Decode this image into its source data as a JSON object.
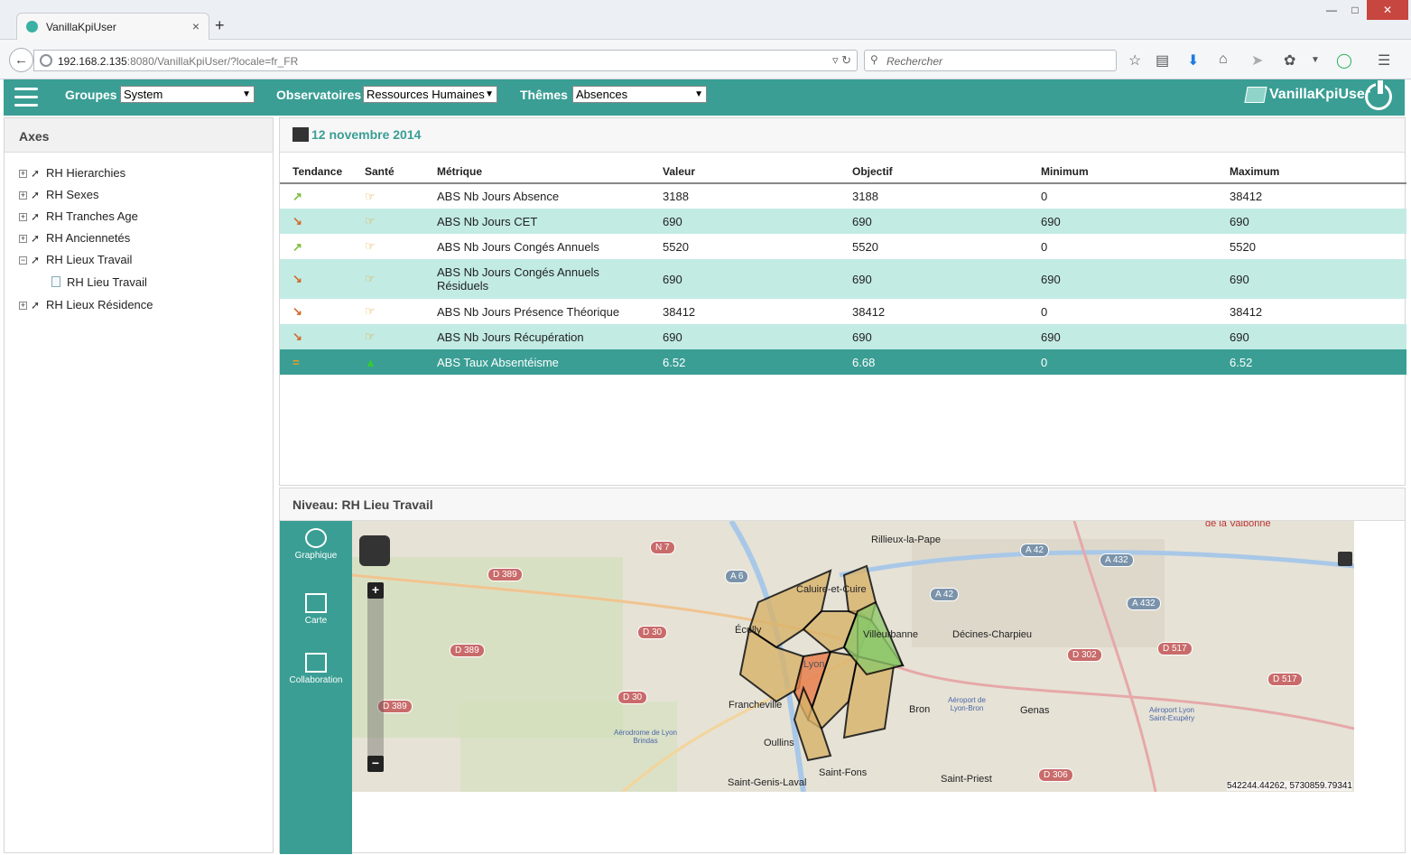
{
  "browser": {
    "tab_title": "VanillaKpiUser",
    "tab_close": "×",
    "new_tab": "+",
    "url_host": "192.168.2.135",
    "url_rest": ":8080/VanillaKpiUser/?locale=fr_FR",
    "search_placeholder": "Rechercher",
    "win_min": "—",
    "win_max": "□",
    "win_close": "✕"
  },
  "header": {
    "groupes_label": "Groupes",
    "groupes_value": "System",
    "observatoires_label": "Observatoires",
    "observatoires_value": "Ressources Humaines",
    "themes_label": "Thêmes",
    "themes_value": "Absences",
    "brand": "VanillaKpiUser"
  },
  "axes": {
    "title": "Axes",
    "items": [
      {
        "label": "RH Hierarchies",
        "toggle": "+"
      },
      {
        "label": "RH Sexes",
        "toggle": "+"
      },
      {
        "label": "RH Tranches Age",
        "toggle": "+"
      },
      {
        "label": "RH Anciennetés",
        "toggle": "+"
      },
      {
        "label": "RH Lieux Travail",
        "toggle": "−"
      },
      {
        "label": "RH Lieu Travail",
        "toggle": ""
      },
      {
        "label": "RH Lieux Résidence",
        "toggle": "+"
      }
    ]
  },
  "metrics": {
    "date": "12 novembre 2014",
    "columns": [
      "Tendance",
      "Santé",
      "Métrique",
      "Valeur",
      "Objectif",
      "Minimum",
      "Maximum"
    ],
    "rows": [
      {
        "trend": "up",
        "health": "hand",
        "metric": "ABS Nb Jours Absence",
        "valeur": "3188",
        "objectif": "3188",
        "minimum": "0",
        "maximum": "38412"
      },
      {
        "trend": "down",
        "health": "hand",
        "metric": "ABS Nb Jours CET",
        "valeur": "690",
        "objectif": "690",
        "minimum": "690",
        "maximum": "690"
      },
      {
        "trend": "up",
        "health": "hand",
        "metric": "ABS Nb Jours Congés Annuels",
        "valeur": "5520",
        "objectif": "5520",
        "minimum": "0",
        "maximum": "5520"
      },
      {
        "trend": "down",
        "health": "hand",
        "metric": "ABS Nb Jours Congés Annuels Résiduels",
        "valeur": "690",
        "objectif": "690",
        "minimum": "690",
        "maximum": "690"
      },
      {
        "trend": "down",
        "health": "hand",
        "metric": "ABS Nb Jours Présence Théorique",
        "valeur": "38412",
        "objectif": "38412",
        "minimum": "0",
        "maximum": "38412"
      },
      {
        "trend": "down",
        "health": "hand",
        "metric": "ABS Nb Jours Récupération",
        "valeur": "690",
        "objectif": "690",
        "minimum": "690",
        "maximum": "690"
      },
      {
        "trend": "equal",
        "health": "good",
        "metric": "ABS Taux Absentéisme",
        "valeur": "6.52",
        "objectif": "6.68",
        "minimum": "0",
        "maximum": "6.52"
      }
    ]
  },
  "map": {
    "title": "Niveau: RH Lieu Travail",
    "side": {
      "graphique": "Graphique",
      "carte": "Carte",
      "collaboration": "Collaboration"
    },
    "places": [
      "Rillieux-la-Pape",
      "Caluire-et-Cuire",
      "Écully",
      "Villeurbanne",
      "Décines-Charpieu",
      "Lyon",
      "Francheville",
      "Bron",
      "Genas",
      "Oullins",
      "Saint-Fons",
      "Saint-Genis-Laval",
      "Saint-Priest",
      "Aéroport de Lyon-Bron",
      "Aérodrome de Lyon Brindas",
      "Aéroport Lyon Saint-Exupéry",
      "de la Valbonne"
    ],
    "roads": [
      "D 389",
      "N 7",
      "A 6",
      "A 42",
      "A 432",
      "D 30",
      "D 302",
      "D 517",
      "D 306"
    ],
    "coords": "542244.44262, 5730859.79341",
    "zoom_in": "+",
    "zoom_out": "−",
    "colors": {
      "orange": "#e8804f",
      "tan": "#d9b36a",
      "green": "#8fc86a"
    }
  }
}
